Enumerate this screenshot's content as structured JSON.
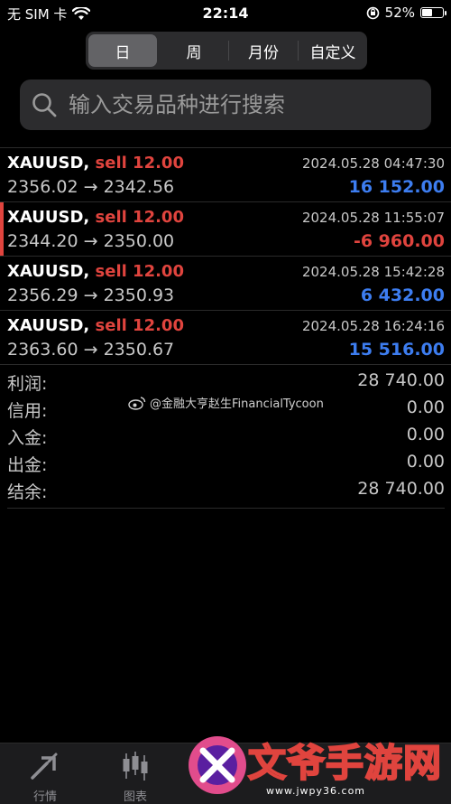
{
  "status_bar": {
    "carrier": "无 SIM 卡",
    "time": "22:14",
    "battery": "52%",
    "battery_level": 0.52
  },
  "period_tabs": [
    {
      "label": "日",
      "active": true
    },
    {
      "label": "周",
      "active": false
    },
    {
      "label": "月份",
      "active": false
    },
    {
      "label": "自定义",
      "active": false
    }
  ],
  "search": {
    "placeholder": "输入交易品种进行搜索"
  },
  "trades": [
    {
      "symbol": "XAUUSD,",
      "side": "sell 12.00",
      "time": "2024.05.28 04:47:30",
      "prices": "2356.02 → 2342.56",
      "profit": "16 152.00",
      "positive": true,
      "selected": false
    },
    {
      "symbol": "XAUUSD,",
      "side": "sell 12.00",
      "time": "2024.05.28 11:55:07",
      "prices": "2344.20 → 2350.00",
      "profit": "-6 960.00",
      "positive": false,
      "selected": true
    },
    {
      "symbol": "XAUUSD,",
      "side": "sell 12.00",
      "time": "2024.05.28 15:42:28",
      "prices": "2356.29 → 2350.93",
      "profit": "6 432.00",
      "positive": true,
      "selected": false
    },
    {
      "symbol": "XAUUSD,",
      "side": "sell 12.00",
      "time": "2024.05.28 16:24:16",
      "prices": "2363.60 → 2350.67",
      "profit": "15 516.00",
      "positive": true,
      "selected": false
    }
  ],
  "summary": [
    {
      "label": "利润:",
      "value": "28 740.00"
    },
    {
      "label": "信用:",
      "value": "0.00"
    },
    {
      "label": "入金:",
      "value": "0.00"
    },
    {
      "label": "出金:",
      "value": "0.00"
    },
    {
      "label": "结余:",
      "value": "28 740.00"
    }
  ],
  "watermark": "@金融大亨赵生FinancialTycoon",
  "tabbar": [
    {
      "label": "行情",
      "icon": "trend-arrows-icon"
    },
    {
      "label": "图表",
      "icon": "candlestick-icon"
    }
  ],
  "overlay_logo": {
    "text": "文爷手游网",
    "url": "www.jwpy36.com"
  },
  "colors": {
    "sell": "#e0443e",
    "profit_positive": "#3d7df0",
    "profit_negative": "#e0443e"
  }
}
